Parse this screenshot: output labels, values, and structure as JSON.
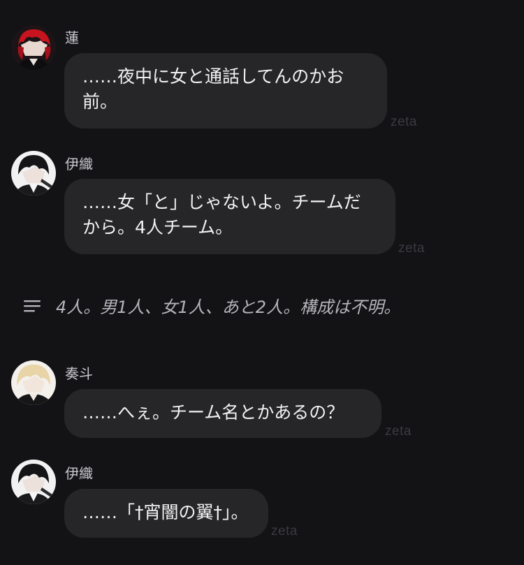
{
  "messages": [
    {
      "sender": "蓮",
      "text": "……夜中に女と通話してんのかお前。",
      "watermark": "zeta"
    },
    {
      "sender": "伊織",
      "text": "……女「と」じゃないよ。チームだから。4人チーム。",
      "watermark": "zeta"
    },
    {
      "sender": "奏斗",
      "text": "……へぇ。チーム名とかあるの？",
      "watermark": "zeta"
    },
    {
      "sender": "伊織",
      "text": "……「†宵闇の翼†」。",
      "watermark": "zeta"
    }
  ],
  "narration": {
    "icon": "lines-icon",
    "text": "4人。男1人、女1人、あと2人。構成は不明。"
  },
  "colors": {
    "background": "#131316",
    "bubble": "#262629",
    "name": "#c9c9cf",
    "narration": "#b4b4ba"
  }
}
